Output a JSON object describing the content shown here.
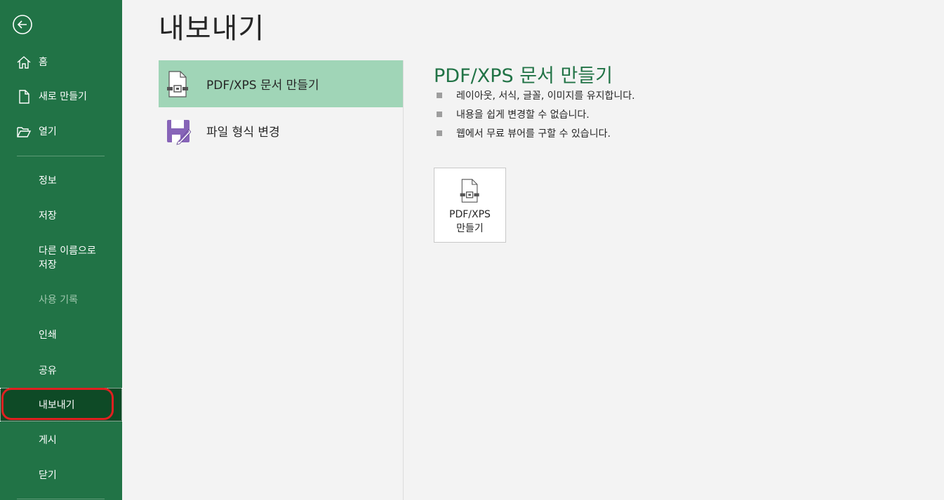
{
  "sidebar": {
    "back_icon": "back-arrow-icon",
    "items": [
      {
        "key": "home",
        "label": "홈",
        "icon": "home-icon"
      },
      {
        "key": "new",
        "label": "새로 만들기",
        "icon": "document-icon"
      },
      {
        "key": "open",
        "label": "열기",
        "icon": "folder-open-icon"
      },
      {
        "key": "info",
        "label": "정보"
      },
      {
        "key": "save",
        "label": "저장"
      },
      {
        "key": "save-as",
        "label": "다른 이름으로\n저장"
      },
      {
        "key": "history",
        "label": "사용 기록",
        "disabled": true
      },
      {
        "key": "print",
        "label": "인쇄"
      },
      {
        "key": "share",
        "label": "공유"
      },
      {
        "key": "export",
        "label": "내보내기",
        "active": true
      },
      {
        "key": "publish",
        "label": "게시"
      },
      {
        "key": "close",
        "label": "닫기"
      }
    ]
  },
  "main": {
    "title": "내보내기",
    "options": [
      {
        "label": "PDF/XPS 문서 만들기",
        "icon": "pdf-document-icon",
        "selected": true
      },
      {
        "label": "파일 형식 변경",
        "icon": "save-as-format-icon",
        "selected": false
      }
    ],
    "detail": {
      "title": "PDF/XPS 문서 만들기",
      "bullets": [
        "레이아웃, 서식, 글꼴, 이미지를 유지합니다.",
        "내용을 쉽게 변경할 수 없습니다.",
        "웹에서 무료 뷰어를 구할 수 있습니다."
      ],
      "button_label": "PDF/XPS\n만들기",
      "button_icon": "pdf-document-icon"
    }
  },
  "colors": {
    "sidebar_bg": "#217346",
    "active_bg": "#0e4a26",
    "selected_option_bg": "#a0d5b7",
    "accent_text": "#217346",
    "highlight_ring": "#e02020"
  }
}
